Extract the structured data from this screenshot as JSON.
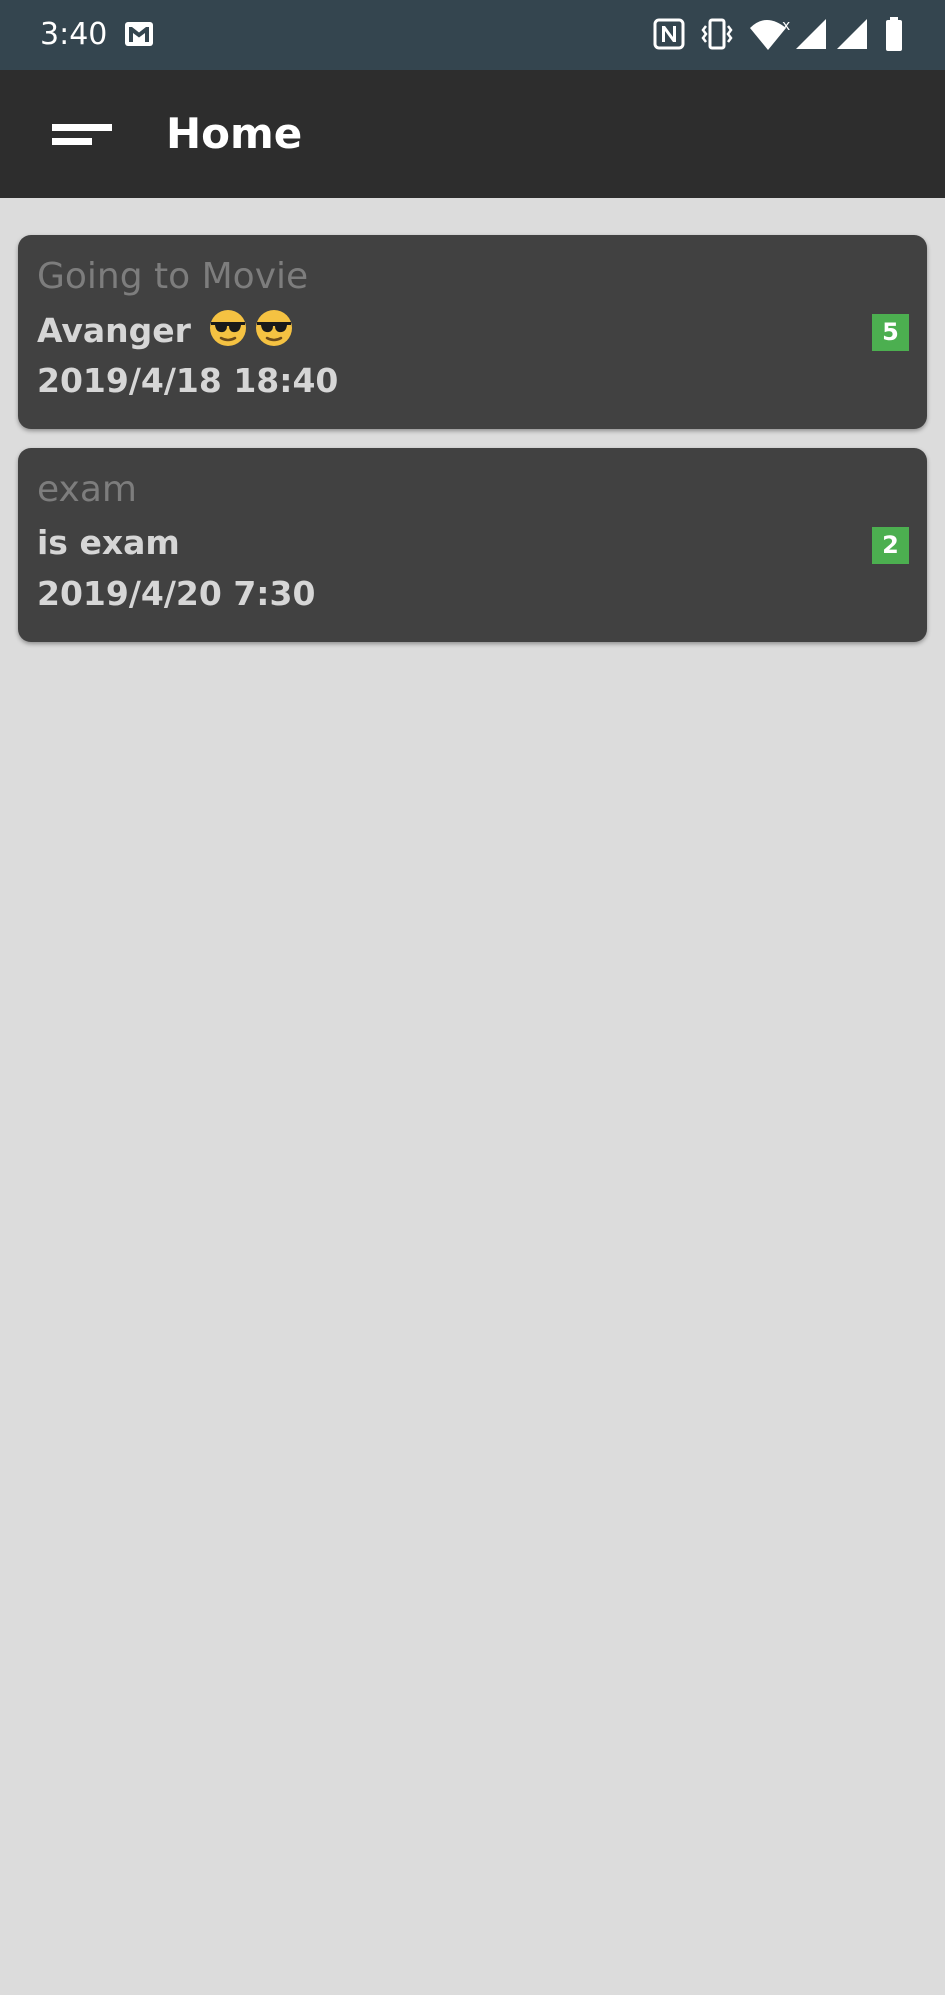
{
  "status_bar": {
    "time": "3:40",
    "icons": [
      "gmail-icon",
      "nfc-icon",
      "vibrate-icon",
      "wifi-icon",
      "signal-icon",
      "signal-icon",
      "battery-icon"
    ],
    "background": "#34454f"
  },
  "app_bar": {
    "title": "Home",
    "menu_icon": "sort-menu-icon",
    "background": "#2d2d2d"
  },
  "cards": [
    {
      "title": "Going to Movie",
      "description": "Avanger",
      "emoji": "sunglasses-face-icon",
      "emoji_count": 2,
      "datetime": "2019/4/18 18:40",
      "badge": "5"
    },
    {
      "title": "exam",
      "description": "is exam",
      "datetime": "2019/4/20 7:30",
      "badge": "2"
    }
  ],
  "colors": {
    "page_background": "#dcdcdc",
    "card_background": "#414141",
    "badge": "#4caf50",
    "title_text": "#7d7d7d",
    "body_text": "#d6d6d6"
  }
}
